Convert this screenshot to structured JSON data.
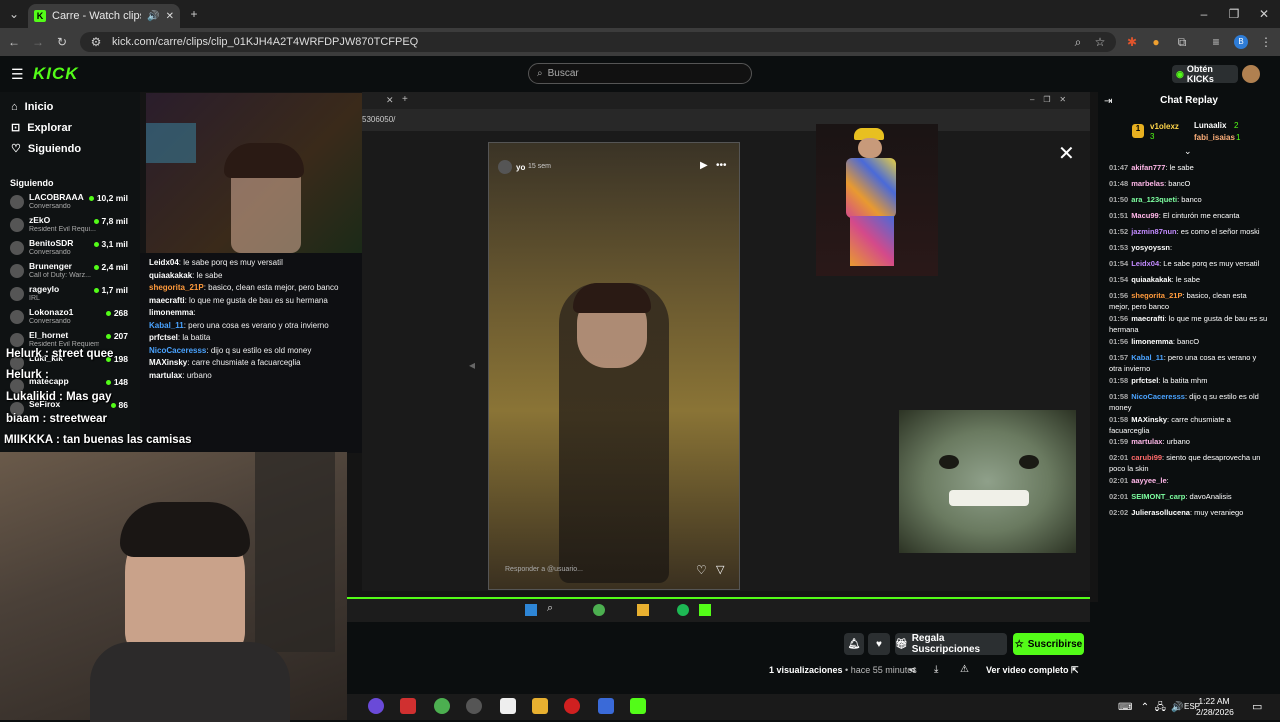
{
  "browser": {
    "tab_title": "Carre - Watch clips on Kick",
    "url": "kick.com/carre/clips/clip_01KJH4A2T4WRFDPJW870TCFPEQ",
    "new_tab_icon": "+"
  },
  "header": {
    "logo": "KICK",
    "search_placeholder": "Buscar",
    "kicks_button": "Obtén KICKs"
  },
  "sidebar": {
    "nav": [
      {
        "label": "Inicio",
        "icon": "home-icon"
      },
      {
        "label": "Explorar",
        "icon": "compass-icon"
      },
      {
        "label": "Siguiendo",
        "icon": "heart-icon"
      }
    ],
    "following_title": "Siguiendo",
    "following": [
      {
        "name": "LACOBRAAA",
        "category": "Conversando",
        "viewers": "10,2 mil"
      },
      {
        "name": "zEkO",
        "category": "Resident Evil Requi...",
        "viewers": "7,8 mil"
      },
      {
        "name": "BenitoSDR",
        "category": "Conversando",
        "viewers": "3,1 mil"
      },
      {
        "name": "Brunenger",
        "category": "Call of Duty: Warz...",
        "viewers": "2,4 mil"
      },
      {
        "name": "rageylo",
        "category": "IRL",
        "viewers": "1,7 mil"
      },
      {
        "name": "Lokonazo1",
        "category": "Conversando",
        "viewers": "268"
      },
      {
        "name": "El_hornet",
        "category": "Resident Evil Requiem",
        "viewers": "207"
      },
      {
        "name": "Luki_kik",
        "category": "",
        "viewers": "198"
      },
      {
        "name": "matecapp",
        "category": "",
        "viewers": "148"
      },
      {
        "name": "SeFirox",
        "category": "",
        "viewers": "86"
      }
    ]
  },
  "stream_chat": [
    {
      "user": "Leidx04",
      "text": "le sabe porq es muy versatil",
      "color": "#ffffff"
    },
    {
      "user": "quiaakakak",
      "text": "le sabe",
      "color": "#ffffff"
    },
    {
      "user": "shegorita_21P",
      "text": "basico, clean esta mejor, pero banco",
      "color": "#ff9a3c"
    },
    {
      "user": "maecrafti",
      "text": "lo que me gusta de bau es su hermana",
      "color": "#ffffff"
    },
    {
      "user": "limonemma",
      "text": "",
      "color": "#ffffff"
    },
    {
      "user": "Kabal_11",
      "text": "pero una cosa es verano y otra invierno",
      "color": "#4aa3ff"
    },
    {
      "user": "prfctsel",
      "text": "la batita",
      "color": "#ffffff"
    },
    {
      "user": "NicoCaceresss",
      "text": "dijo q su estilo es old money",
      "color": "#4aa3ff"
    },
    {
      "user": "MAXinsky",
      "text": "carre chusmiate a facuarceglia",
      "color": "#ffffff"
    },
    {
      "user": "martulax",
      "text": "urbano",
      "color": "#ffffff"
    }
  ],
  "overlay_chat": [
    {
      "user": "Helurk",
      "text": "street quee"
    },
    {
      "user": "Helurk",
      "text": ""
    },
    {
      "user": "Lukalikid",
      "text": "Mas gay"
    },
    {
      "user": "biaam",
      "text": "streetwear"
    },
    {
      "user": "MIIKKKA",
      "text": "tan buenas las camisas"
    }
  ],
  "instagram": {
    "user": "yo",
    "time": "15 sem",
    "reply_placeholder": "Responder a @usuario..."
  },
  "inner_browser": {
    "url_fragment": "5306050/"
  },
  "actions": {
    "gift_subs": "Regala Suscripciones",
    "subscribe": "Suscribirse",
    "views": "1 visualizaciones",
    "time_ago": "hace 55 minutos",
    "full_video": "Ver video completo"
  },
  "chat_replay": {
    "title": "Chat Replay",
    "top_gifters": [
      {
        "name": "v1olexz",
        "count": "3"
      },
      {
        "name": "Lunaalix",
        "count": "2"
      },
      {
        "name": "fabi_isaias",
        "count": "1"
      }
    ],
    "messages": [
      {
        "time": "01:47",
        "user": "akifan777",
        "text": "le sabe",
        "color": "#ffb7e8"
      },
      {
        "time": "01:48",
        "user": "marbelas",
        "text": "bancO",
        "color": "#ffb7e8"
      },
      {
        "time": "01:50",
        "user": "ara_123queti",
        "text": "banco",
        "color": "#7dffa0"
      },
      {
        "time": "01:51",
        "user": "Macu99",
        "text": "El cinturón me encanta",
        "color": "#ffb7e8"
      },
      {
        "time": "01:52",
        "user": "jazmin87nun",
        "text": "es como el señor moski",
        "color": "#c38bff"
      },
      {
        "time": "01:53",
        "user": "yosyoyssn",
        "text": "",
        "color": "#ffffff"
      },
      {
        "time": "01:54",
        "user": "Leidx04",
        "text": "Le sabe porq es muy versatil",
        "color": "#c38bff"
      },
      {
        "time": "01:54",
        "user": "quiaakakak",
        "text": "le sabe",
        "color": "#ffffff"
      },
      {
        "time": "01:56",
        "user": "shegorita_21P",
        "text": "basico, clean esta mejor, pero banco",
        "color": "#ff9a3c"
      },
      {
        "time": "01:56",
        "user": "maecrafti",
        "text": "lo que me gusta de bau es su hermana",
        "color": "#ffffff"
      },
      {
        "time": "01:56",
        "user": "limonemma",
        "text": "bancO",
        "color": "#ffffff"
      },
      {
        "time": "01:57",
        "user": "Kabal_11",
        "text": "pero una cosa es verano y otra invierno",
        "color": "#4aa3ff"
      },
      {
        "time": "01:58",
        "user": "prfctsel",
        "text": "la batita mhm",
        "color": "#ffffff"
      },
      {
        "time": "01:58",
        "user": "NicoCaceresss",
        "text": "dijo q su estilo es old money",
        "color": "#4aa3ff"
      },
      {
        "time": "01:58",
        "user": "MAXinsky",
        "text": "carre chusmiate a facuarceglia",
        "color": "#ffffff"
      },
      {
        "time": "01:59",
        "user": "martulax",
        "text": "urbano",
        "color": "#ffb7e8"
      },
      {
        "time": "02:01",
        "user": "carubi99",
        "text": "siento que desaprovecha un poco la skin",
        "color": "#ff6a6a"
      },
      {
        "time": "02:01",
        "user": "aayyee_le",
        "text": "",
        "color": "#ffb7e8"
      },
      {
        "time": "02:01",
        "user": "SEIMONT_carp",
        "text": "davoAnalisis",
        "color": "#7dffa0"
      },
      {
        "time": "02:02",
        "user": "Julierasollucena",
        "text": "muy veraniego",
        "color": "#ffffff"
      }
    ]
  },
  "taskbar": {
    "time": "1:22 AM",
    "date": "2/28/2026",
    "lang": "ESP"
  },
  "colors": {
    "accent": "#53fc18",
    "background": "#0b0e0f"
  }
}
